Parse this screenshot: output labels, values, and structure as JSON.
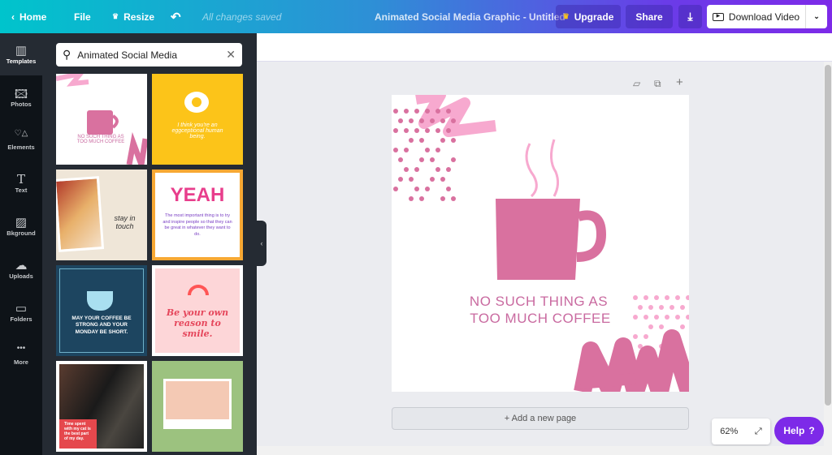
{
  "topbar": {
    "home": "Home",
    "file": "File",
    "resize": "Resize",
    "status": "All changes saved",
    "doc_title": "Animated Social Media Graphic - Untitled",
    "upgrade": "Upgrade",
    "share": "Share",
    "download": "Download Video"
  },
  "rail": [
    {
      "label": "Templates",
      "icon": "▥"
    },
    {
      "label": "Photos",
      "icon": "🖾"
    },
    {
      "label": "Elements",
      "icon": "♡△"
    },
    {
      "label": "Text",
      "icon": "T"
    },
    {
      "label": "Bkground",
      "icon": "▨"
    },
    {
      "label": "Uploads",
      "icon": "☁"
    },
    {
      "label": "Folders",
      "icon": "▭"
    },
    {
      "label": "More",
      "icon": "•••"
    }
  ],
  "search": {
    "value": "Animated Social Media"
  },
  "templates": [
    {
      "text": "NO SUCH THING AS TOO MUCH COFFEE",
      "bg": "#ffffff",
      "color": "#c96aa0"
    },
    {
      "text": "I think you're an eggceptional human being.",
      "bg": "#fcc419",
      "color": "#fff"
    },
    {
      "text": "stay in touch",
      "bg": "#efe6d8",
      "color": "#333"
    },
    {
      "text": "YEAH",
      "sub": "The most important thing is to try and inspire people so that they can be great in whatever they want to do.",
      "bg": "#ffffff",
      "color": "#7a3fc4"
    },
    {
      "text": "MAY YOUR COFFEE BE STRONG AND YOUR MONDAY BE SHORT.",
      "bg": "#1d4560",
      "color": "#fff"
    },
    {
      "text": "Be your own reason to smile.",
      "bg": "#fdd6d8",
      "color": "#e5475c"
    },
    {
      "text": "Time spent with my cat is the best part of my day.",
      "bg": "#2a2424",
      "color": "#fff"
    },
    {
      "text": "",
      "bg": "#9cc27f",
      "color": "#fff"
    }
  ],
  "canvas": {
    "headline_1": "NO SUCH THING AS",
    "headline_2": "TOO MUCH COFFEE",
    "pink": "#d9719f",
    "light_pink": "#f7a9cf"
  },
  "add_page": "+ Add a new page",
  "zoom": "62%",
  "help": "Help",
  "help_icon": "?"
}
